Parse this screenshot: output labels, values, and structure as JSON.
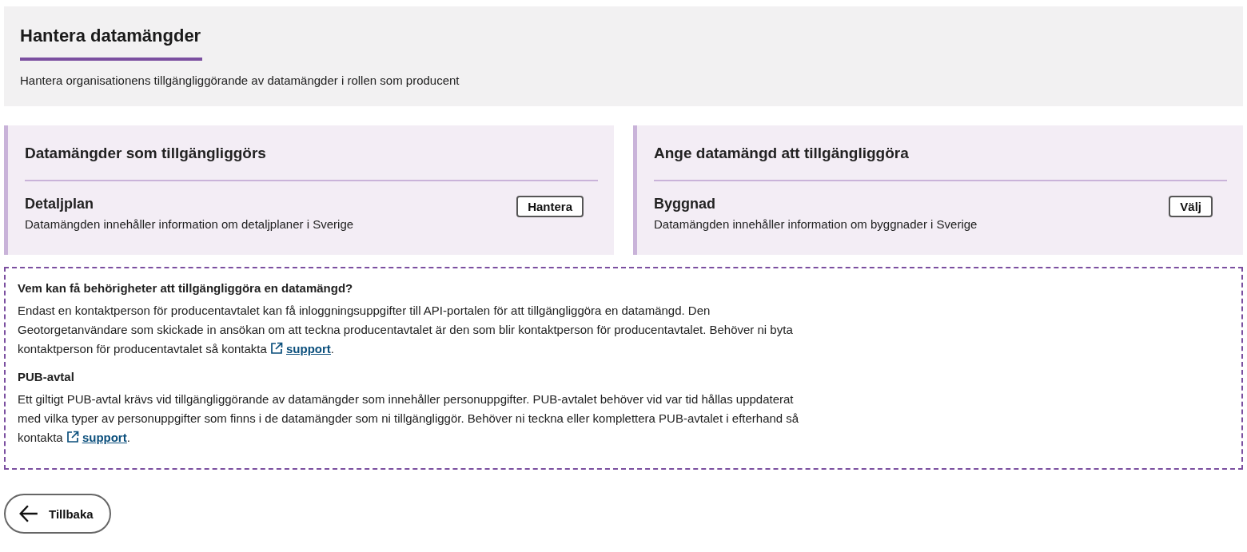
{
  "header": {
    "title": "Hantera datamängder",
    "description": "Hantera organisationens tillgängliggörande av datamängder i rollen som producent"
  },
  "panels": [
    {
      "title": "Datamängder som tillgängliggörs",
      "datasets": [
        {
          "name": "Detaljplan",
          "description": "Datamängden innehåller information om detaljplaner i Sverige",
          "action": "Hantera"
        }
      ]
    },
    {
      "title": "Ange datamängd att tillgängliggöra",
      "datasets": [
        {
          "name": "Byggnad",
          "description": "Datamängden innehåller information om byggnader i Sverige",
          "action": "Välj"
        }
      ]
    }
  ],
  "info": [
    {
      "heading": "Vem kan få behörigheter att tillgängliggöra en datamängd?",
      "text": "Endast en kontaktperson för producentavtalet kan få inloggningsuppgifter till API-portalen för att tillgängliggöra en datamängd. Den Geotorgetanvändare som skickade in ansökan om att teckna producentavtalet är den som blir kontaktperson för producentavtalet. Behöver ni byta kontaktperson för producentavtalet så kontakta",
      "link": "support",
      "after": "."
    },
    {
      "heading": "PUB-avtal",
      "text": "Ett giltigt PUB-avtal krävs vid tillgängliggörande av datamängder som innehåller personuppgifter. PUB-avtalet behöver vid var tid hållas uppdaterat med vilka typer av personuppgifter som finns i de datamängder som ni tillgängliggör. Behöver ni teckna eller komplettera PUB-avtalet i efterhand så kontakta",
      "link": "support",
      "after": "."
    }
  ],
  "back_button": {
    "label": "Tillbaka"
  }
}
